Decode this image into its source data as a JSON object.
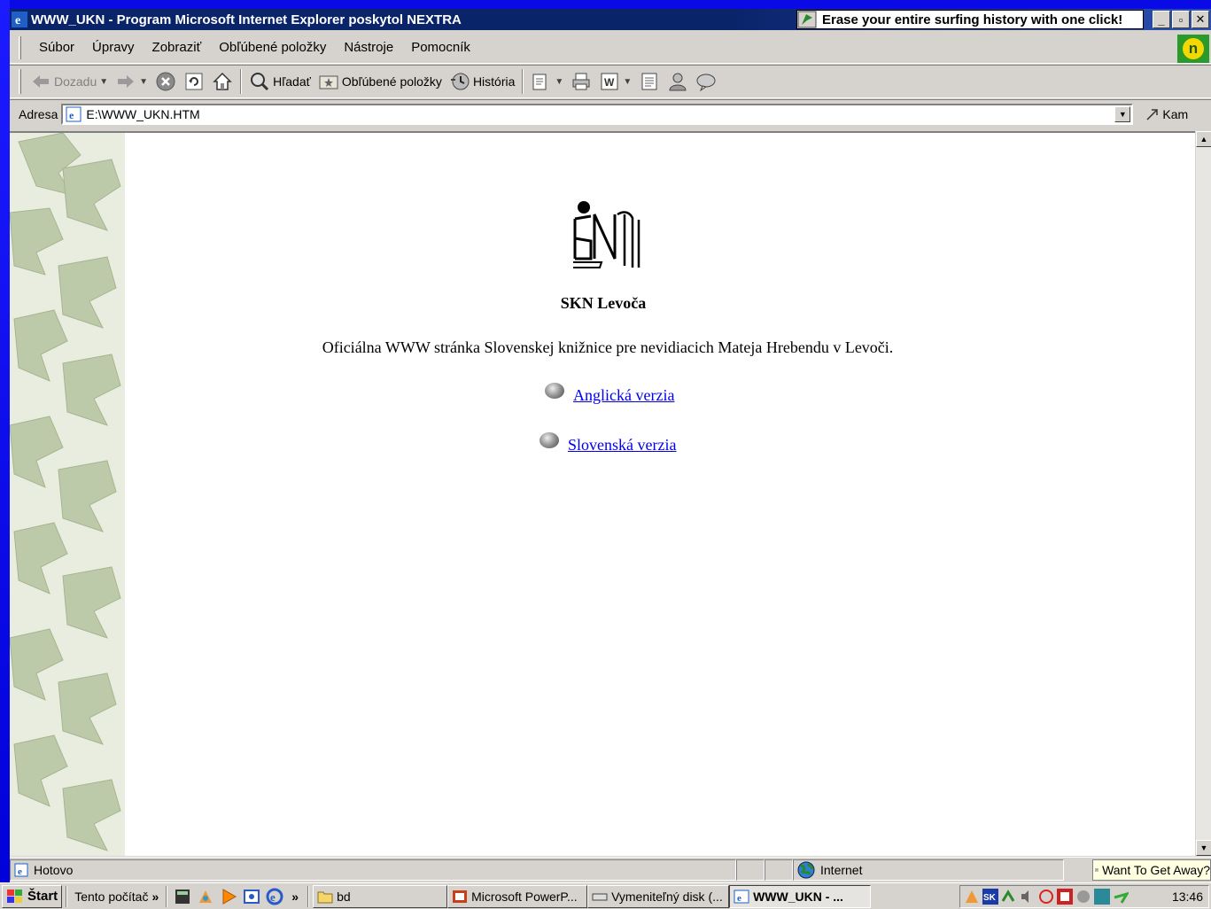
{
  "window": {
    "title": "WWW_UKN - Program Microsoft Internet Explorer poskytol NEXTRA",
    "ad_text": "Erase your entire surfing history with one click!"
  },
  "menu": [
    "Súbor",
    "Úpravy",
    "Zobraziť",
    "Obľúbené položky",
    "Nástroje",
    "Pomocník"
  ],
  "toolbar": {
    "back": "Dozadu",
    "search": "Hľadať",
    "favorites": "Obľúbené položky",
    "history": "História"
  },
  "address": {
    "label": "Adresa",
    "value": "E:\\WWW_UKN.HTM",
    "go": "Kam"
  },
  "page": {
    "title": "SKN Levoča",
    "description": "Oficiálna WWW stránka Slovenskej knižnice pre nevidiacich Mateja Hrebendu v Levoči.",
    "links": [
      "Anglická verzia",
      "Slovenská verzia"
    ]
  },
  "status": {
    "text": "Hotovo",
    "zone": "Internet",
    "ad": "Want To Get Away?"
  },
  "taskbar": {
    "start": "Štart",
    "my_computer": "Tento počítač",
    "folder": "bd",
    "tasks": [
      "Microsoft PowerP...",
      "Vymeniteľný disk (...",
      "WWW_UKN - ..."
    ],
    "clock": "13:46"
  },
  "colors": {
    "titlebar": "#0a246a",
    "chrome": "#d6d3ce",
    "link": "#0000ee",
    "desktop": "#0a0ae6"
  }
}
